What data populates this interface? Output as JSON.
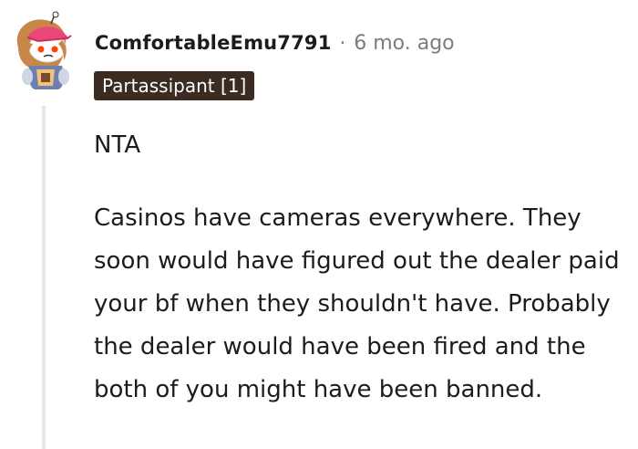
{
  "comment": {
    "username": "ComfortableEmu7791",
    "separator": "·",
    "timestamp": "6 mo. ago",
    "flair": "Partassipant [1]",
    "paragraphs": [
      "NTA",
      "Casinos have cameras everywhere. They soon would have figured out the dealer paid your bf when they shouldn't have. Probably the dealer would have been fired and the both of you might have been banned."
    ]
  },
  "colors": {
    "text": "#1c1c1c",
    "meta": "#7c7c7c",
    "flair_bg": "#3b2b21",
    "flair_text": "#ffffff",
    "thread_line": "#e6e6e6"
  },
  "icons": {
    "avatar": "snoo-avatar-icon"
  }
}
